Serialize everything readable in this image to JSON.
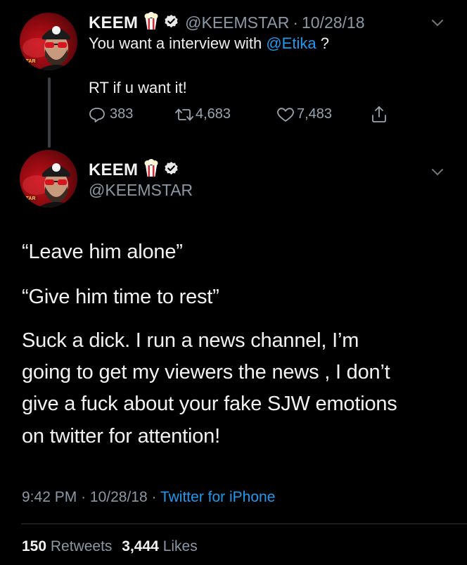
{
  "tweet1": {
    "name": "KEEM",
    "handle": "@KEEMSTAR",
    "separator": "·",
    "date": "10/28/18",
    "line1_prefix": "You want a interview with ",
    "line1_mention": "@Etika",
    "line1_suffix": " ?",
    "line2": "RT if u want it!",
    "replies": "383",
    "retweets": "4,683",
    "likes": "7,483",
    "avatar_badge": "STAR"
  },
  "tweet2": {
    "name": "KEEM",
    "handle": "@KEEMSTAR",
    "avatar_badge": "STAR",
    "paragraphs": [
      "“Leave him alone”",
      "“Give him time to rest”"
    ],
    "body_lines": [
      "Suck a dick. I run a news channel, I’m",
      "going to get my viewers the news , I don’t",
      "give a fuck about your fake SJW emotions",
      "on twitter for attention!"
    ],
    "time": "9:42 PM",
    "sep": "·",
    "date": "10/28/18",
    "sep2": "·",
    "source": "Twitter for iPhone",
    "retweet_count": "150",
    "retweet_label": "Retweets",
    "like_count": "3,444",
    "like_label": "Likes"
  },
  "colors": {
    "background": "#000000",
    "accent": "#1d9bf0",
    "secondary_text": "#8b98a5",
    "primary_text": "#f2f2f2",
    "verified": "#e8e8e8"
  },
  "icons": {
    "reply": "reply-icon",
    "retweet": "retweet-icon",
    "like": "heart-icon",
    "share": "share-icon",
    "verified": "verified-badge-icon",
    "popcorn": "popcorn-emoji-icon",
    "more": "chevron-down-icon"
  }
}
